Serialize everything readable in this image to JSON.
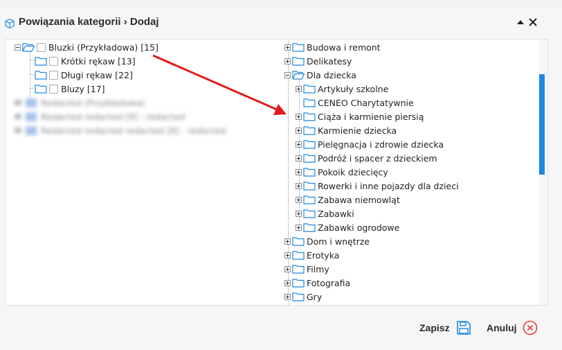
{
  "modal": {
    "title": "Powiązania kategorii › Dodaj",
    "icons": {
      "title": "cube-icon",
      "collapse": "triangle-up-icon",
      "close": "close-icon"
    }
  },
  "left_tree": {
    "root": {
      "label": "Bluzki (Przykładowa) [15]",
      "icon": "folder-open-icon"
    },
    "children": [
      {
        "label": "Krótki rękaw [13]",
        "icon": "folder-icon"
      },
      {
        "label": "Długi rękaw [22]",
        "icon": "folder-icon"
      },
      {
        "label": "Bluzy [17]",
        "icon": "folder-icon"
      }
    ],
    "blurred_rows": [
      "Redacted (Przykładowa) [8]",
      "Redacted redacted [9] - redacted",
      "Redacted redacted redacted [8] - redacted"
    ]
  },
  "right_tree": {
    "items": [
      {
        "label": "Budowa i remont",
        "expander": "plus"
      },
      {
        "label": "Delikatesy",
        "expander": "plus"
      },
      {
        "label": "Dla dziecka",
        "expander": "minus",
        "open": true,
        "children": [
          {
            "label": "Artykuły szkolne",
            "expander": "plus"
          },
          {
            "label": "CENEO Charytatywnie",
            "expander": "none"
          },
          {
            "label": "Ciąża i karmienie piersią",
            "expander": "plus"
          },
          {
            "label": "Karmienie dziecka",
            "expander": "plus"
          },
          {
            "label": "Pielęgnacja i zdrowie dziecka",
            "expander": "plus"
          },
          {
            "label": "Podróż i spacer z dzieckiem",
            "expander": "plus"
          },
          {
            "label": "Pokoik dziecięcy",
            "expander": "plus"
          },
          {
            "label": "Rowerki i inne pojazdy dla dzieci",
            "expander": "plus"
          },
          {
            "label": "Zabawa niemowląt",
            "expander": "plus"
          },
          {
            "label": "Zabawki",
            "expander": "plus"
          },
          {
            "label": "Zabawki ogrodowe",
            "expander": "plus"
          }
        ]
      },
      {
        "label": "Dom i wnętrze",
        "expander": "plus"
      },
      {
        "label": "Erotyka",
        "expander": "plus"
      },
      {
        "label": "Filmy",
        "expander": "plus"
      },
      {
        "label": "Fotografia",
        "expander": "plus"
      },
      {
        "label": "Gry",
        "expander": "plus"
      }
    ]
  },
  "footer": {
    "save_label": "Zapisz",
    "save_icon": "floppy-disk-icon",
    "cancel_label": "Anuluj",
    "cancel_icon": "circle-x-icon"
  },
  "colors": {
    "accent": "#1e88e5",
    "folder_outline": "#1e88e5",
    "arrow": "#e01b1b",
    "cancel_icon": "#e53935"
  }
}
